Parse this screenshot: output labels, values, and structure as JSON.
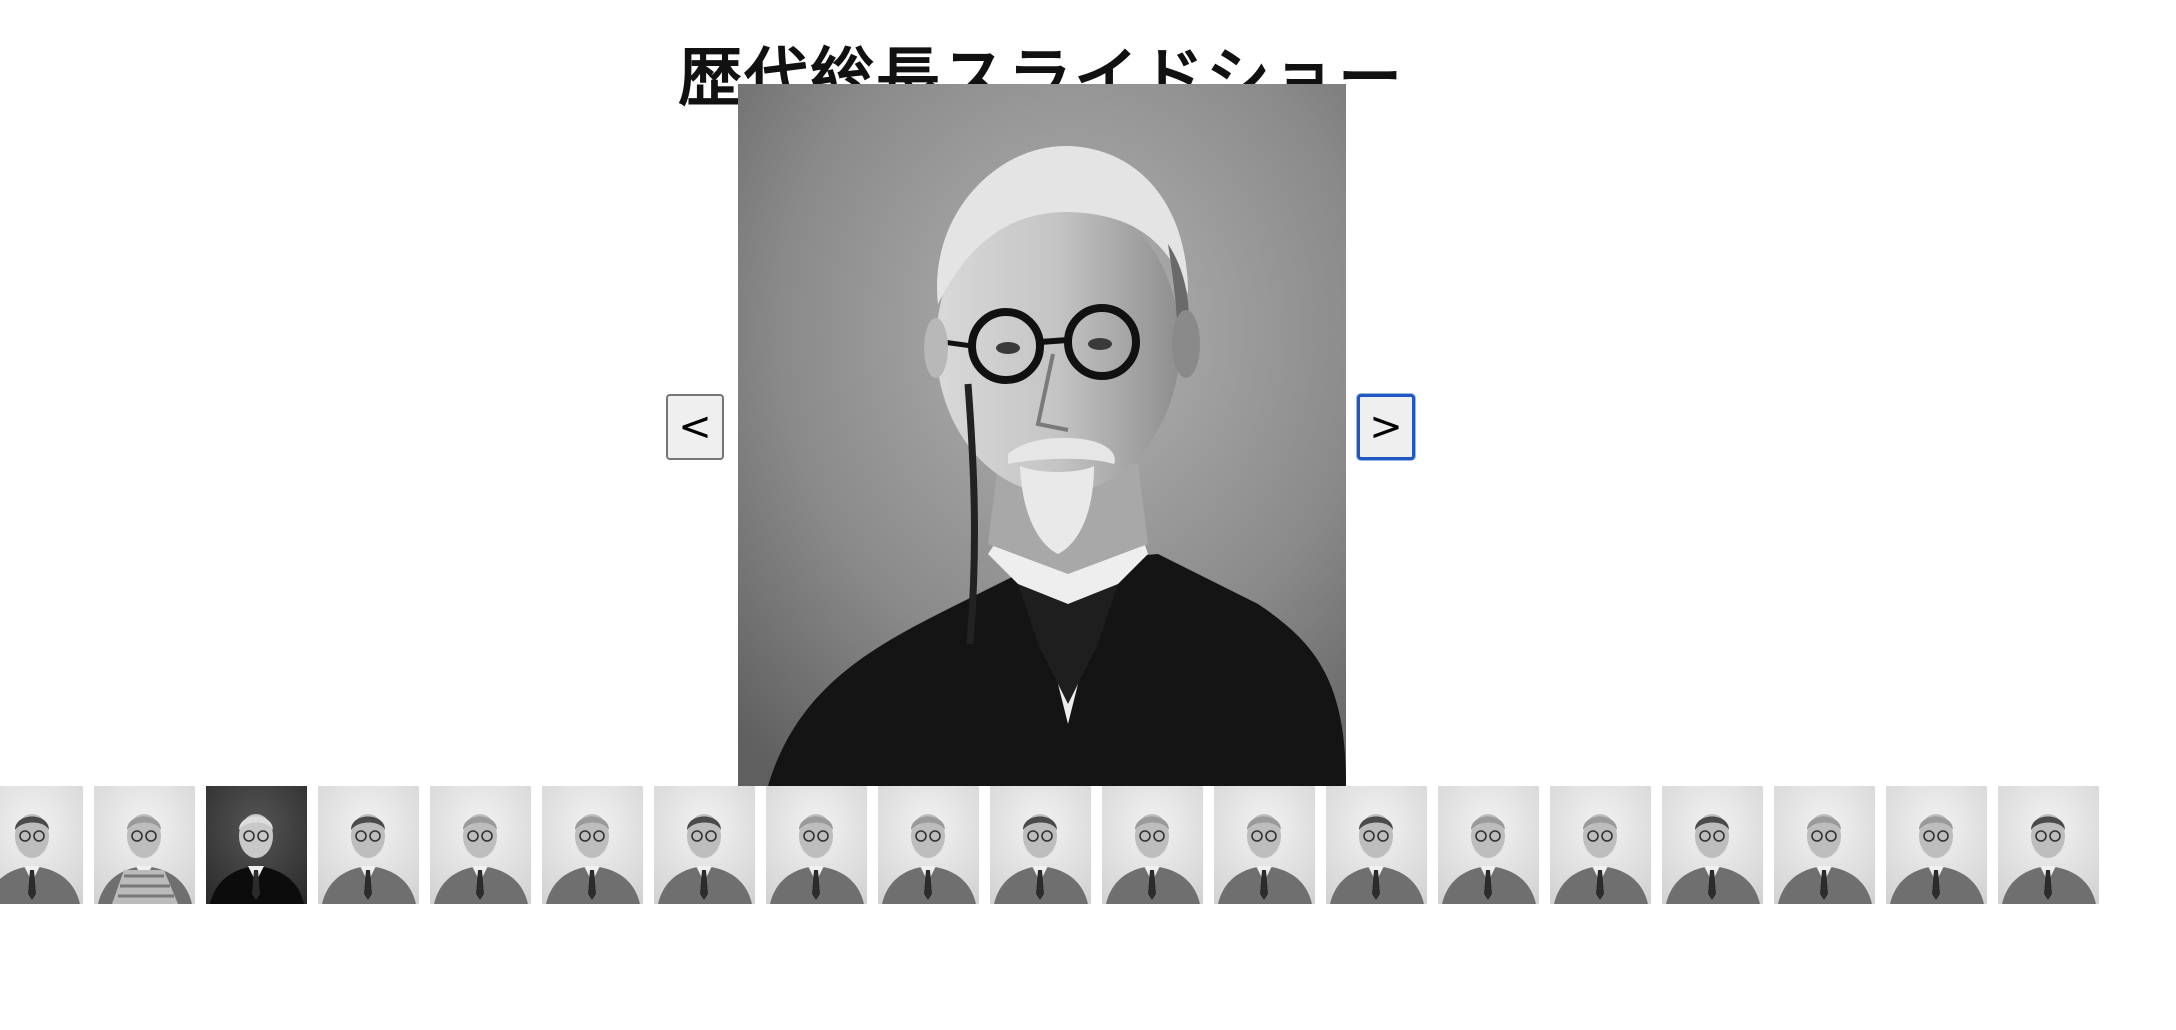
{
  "page": {
    "title": "歴代総長スライドショー"
  },
  "viewer": {
    "current_index": 2,
    "main_image_alt": "current-president-portrait",
    "prev_label": "<",
    "next_label": ">"
  },
  "thumbnails": [
    {
      "name": "thumb-1",
      "tone": "light",
      "attire": "suit"
    },
    {
      "name": "thumb-2",
      "tone": "light",
      "attire": "court-uniform"
    },
    {
      "name": "thumb-3",
      "tone": "dark",
      "attire": "suit",
      "selected": true
    },
    {
      "name": "thumb-4",
      "tone": "light",
      "attire": "suit"
    },
    {
      "name": "thumb-5",
      "tone": "light",
      "attire": "suit"
    },
    {
      "name": "thumb-6",
      "tone": "light",
      "attire": "suit"
    },
    {
      "name": "thumb-7",
      "tone": "light",
      "attire": "suit"
    },
    {
      "name": "thumb-8",
      "tone": "light",
      "attire": "suit"
    },
    {
      "name": "thumb-9",
      "tone": "light",
      "attire": "suit"
    },
    {
      "name": "thumb-10",
      "tone": "light",
      "attire": "suit"
    },
    {
      "name": "thumb-11",
      "tone": "light",
      "attire": "suit"
    },
    {
      "name": "thumb-12",
      "tone": "light",
      "attire": "suit"
    },
    {
      "name": "thumb-13",
      "tone": "light",
      "attire": "suit"
    },
    {
      "name": "thumb-14",
      "tone": "light",
      "attire": "suit"
    },
    {
      "name": "thumb-15",
      "tone": "light",
      "attire": "suit"
    },
    {
      "name": "thumb-16",
      "tone": "light",
      "attire": "suit"
    },
    {
      "name": "thumb-17",
      "tone": "light",
      "attire": "suit"
    },
    {
      "name": "thumb-18",
      "tone": "light",
      "attire": "suit"
    },
    {
      "name": "thumb-19",
      "tone": "light",
      "attire": "suit"
    }
  ],
  "colors": {
    "selected_button_border": "#2057c2",
    "button_bg": "#efefef"
  }
}
